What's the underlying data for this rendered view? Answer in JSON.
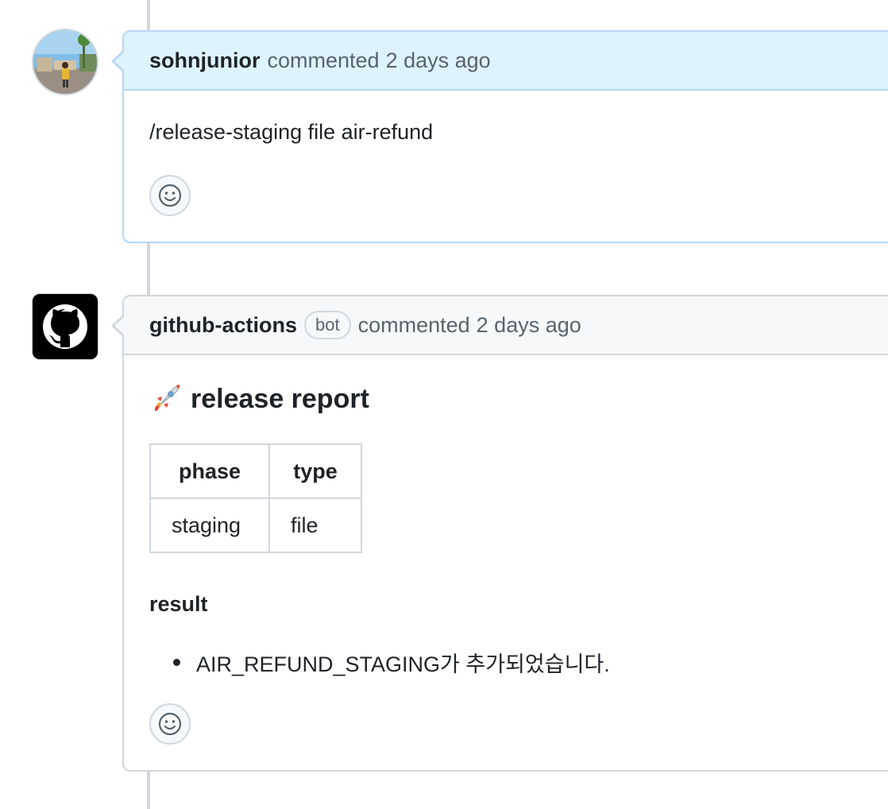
{
  "comments": [
    {
      "author": "sohnjunior",
      "action": "commented",
      "time": "2 days ago",
      "body": "/release-staging file air-refund",
      "avatar_icon": "user-photo-avatar",
      "reaction_icon": "smiley-icon"
    },
    {
      "author": "github-actions",
      "badge": "bot",
      "action": "commented",
      "time": "2 days ago",
      "avatar_icon": "github-octocat-icon",
      "reaction_icon": "smiley-icon",
      "report": {
        "title": "release report",
        "title_icon": "rocket-icon",
        "table": {
          "headers": [
            "phase",
            "type"
          ],
          "rows": [
            [
              "staging",
              "file"
            ]
          ]
        },
        "result_heading": "result",
        "result_items": [
          "AIR_REFUND_STAGING가 추가되었습니다."
        ]
      }
    }
  ],
  "colors": {
    "highlight_header": "#ddf4ff",
    "highlight_border": "#b6d7f5",
    "border": "#d0d7de",
    "muted_text": "#59636e",
    "text": "#1f2328"
  }
}
